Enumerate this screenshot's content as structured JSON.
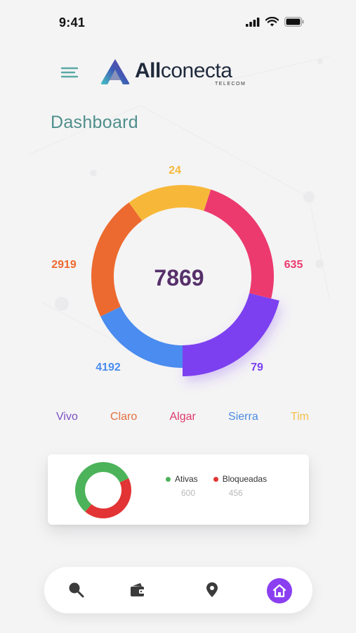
{
  "status_bar": {
    "time": "9:41",
    "icons": [
      "signal-icon",
      "wifi-icon",
      "battery-icon"
    ]
  },
  "header": {
    "menu_icon": "hamburger-menu-icon",
    "logo": {
      "name_bold": "All",
      "name_rest": "conecta",
      "sub": "TELECOM"
    }
  },
  "page": {
    "title": "Dashboard"
  },
  "chart_data": {
    "type": "pie",
    "variant": "donut",
    "total": "7869",
    "series": [
      {
        "name": "Vivo",
        "value": 79,
        "label": "79",
        "color": "#7b3ff0"
      },
      {
        "name": "Claro",
        "value": 2919,
        "label": "2919",
        "color": "#ec6a2f"
      },
      {
        "name": "Algar",
        "value": 635,
        "label": "635",
        "color": "#ec3a6e"
      },
      {
        "name": "Sierra",
        "value": 4192,
        "label": "4192",
        "color": "#4a8cef"
      },
      {
        "name": "Tim",
        "value": 24,
        "label": "24",
        "color": "#f7b83a"
      }
    ]
  },
  "legend": [
    {
      "label": "Vivo",
      "color": "#7d4fc4"
    },
    {
      "label": "Claro",
      "color": "#e0703f"
    },
    {
      "label": "Algar",
      "color": "#de3a6a"
    },
    {
      "label": "Sierra",
      "color": "#4a8be0"
    },
    {
      "label": "Tim",
      "color": "#f3c04b"
    }
  ],
  "status_card": {
    "chart": {
      "type": "pie",
      "series": [
        {
          "name": "Ativas",
          "value": 600,
          "color": "#4cb35a"
        },
        {
          "name": "Bloqueadas",
          "value": 456,
          "color": "#e23434"
        }
      ]
    },
    "items": [
      {
        "label": "Ativas",
        "count": "600",
        "color": "#4cb35a"
      },
      {
        "label": "Bloqueadas",
        "count": "456",
        "color": "#e23434"
      }
    ]
  },
  "bottom_nav": {
    "items": [
      {
        "icon": "search-icon",
        "active": false
      },
      {
        "icon": "wallet-icon",
        "active": false
      },
      {
        "icon": "location-pin-icon",
        "active": false
      },
      {
        "icon": "home-icon",
        "active": true
      }
    ],
    "active_color": "#8a3ff0"
  }
}
